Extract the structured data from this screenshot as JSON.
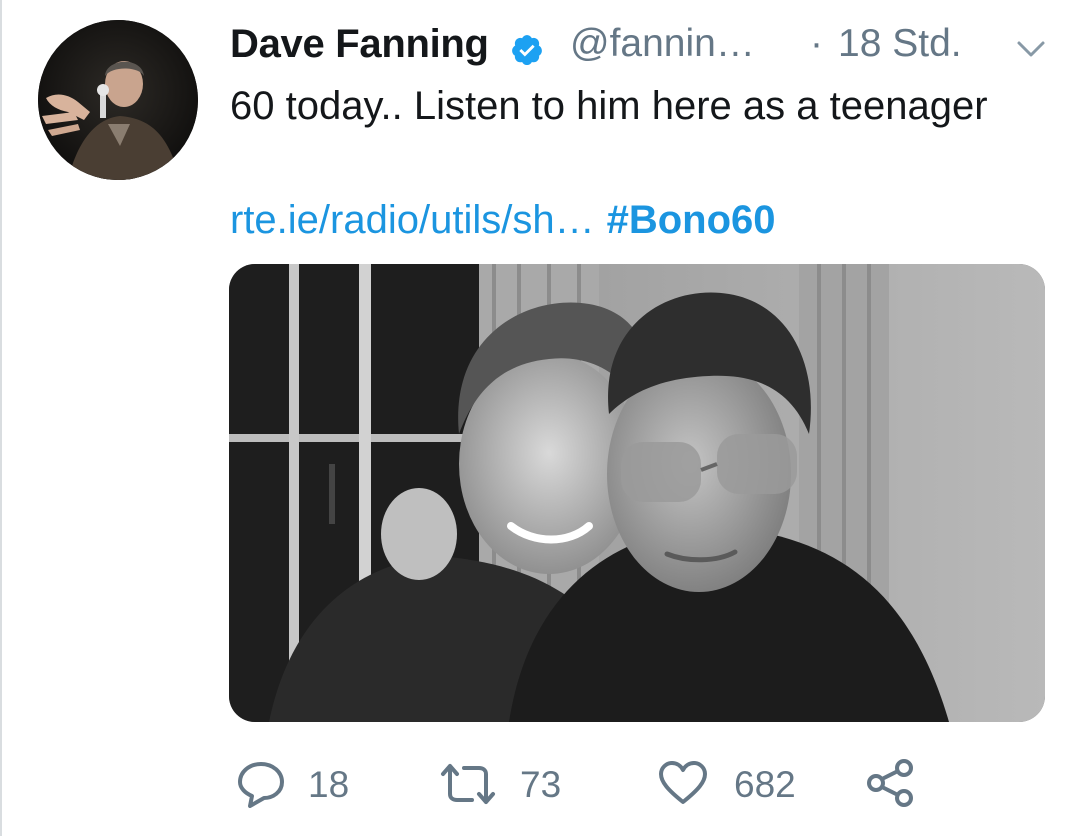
{
  "tweet": {
    "author": {
      "name": "Dave Fanning",
      "handle": "@fannin…",
      "verified": true
    },
    "separator": "·",
    "time": "18 Std.",
    "text": "60 today.. Listen to him here as a teenager",
    "link": "rte.ie/radio/utils/sh…",
    "hashtag": "#Bono60",
    "media": {
      "kind": "photo",
      "style": "black and white"
    },
    "actions": {
      "replies": "18",
      "retweets": "73",
      "likes": "682"
    }
  },
  "colors": {
    "link": "#1b95e0",
    "muted": "#657786",
    "text": "#14171a",
    "verified_badge": "#1da1f2"
  },
  "icons": [
    "verified-badge-icon",
    "chevron-down-icon",
    "reply-icon",
    "retweet-icon",
    "like-icon",
    "share-icon"
  ]
}
